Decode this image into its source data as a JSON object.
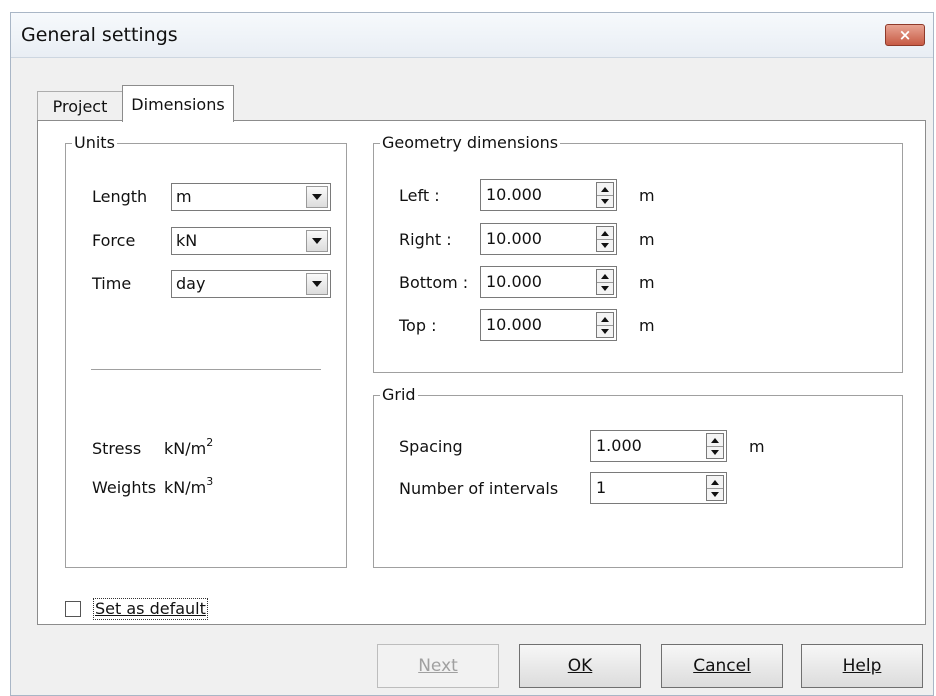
{
  "window": {
    "title": "General settings",
    "close_label": "×"
  },
  "tabs": [
    {
      "label": "Project",
      "selected": false
    },
    {
      "label": "Dimensions",
      "selected": true
    }
  ],
  "units": {
    "legend": "Units",
    "rows": [
      {
        "label": "Length",
        "value": "m"
      },
      {
        "label": "Force",
        "value": "kN"
      },
      {
        "label": "Time",
        "value": "day"
      }
    ],
    "derived": [
      {
        "label": "Stress",
        "unit_base": "kN/m",
        "unit_exp": "2"
      },
      {
        "label": "Weights",
        "unit_base": "kN/m",
        "unit_exp": "3"
      }
    ]
  },
  "geometry": {
    "legend": "Geometry dimensions",
    "rows": [
      {
        "label": "Left :",
        "value": "10.000",
        "unit": "m"
      },
      {
        "label": "Right :",
        "value": "10.000",
        "unit": "m"
      },
      {
        "label": "Bottom :",
        "value": "10.000",
        "unit": "m"
      },
      {
        "label": "Top :",
        "value": "10.000",
        "unit": "m"
      }
    ]
  },
  "grid": {
    "legend": "Grid",
    "spacing_label": "Spacing",
    "spacing_value": "1.000",
    "spacing_unit": "m",
    "intervals_label": "Number of intervals",
    "intervals_value": "1"
  },
  "default_checkbox": {
    "label": "Set as default",
    "checked": false
  },
  "buttons": {
    "next": "Next",
    "ok": "OK",
    "cancel": "Cancel",
    "help": "Help"
  }
}
